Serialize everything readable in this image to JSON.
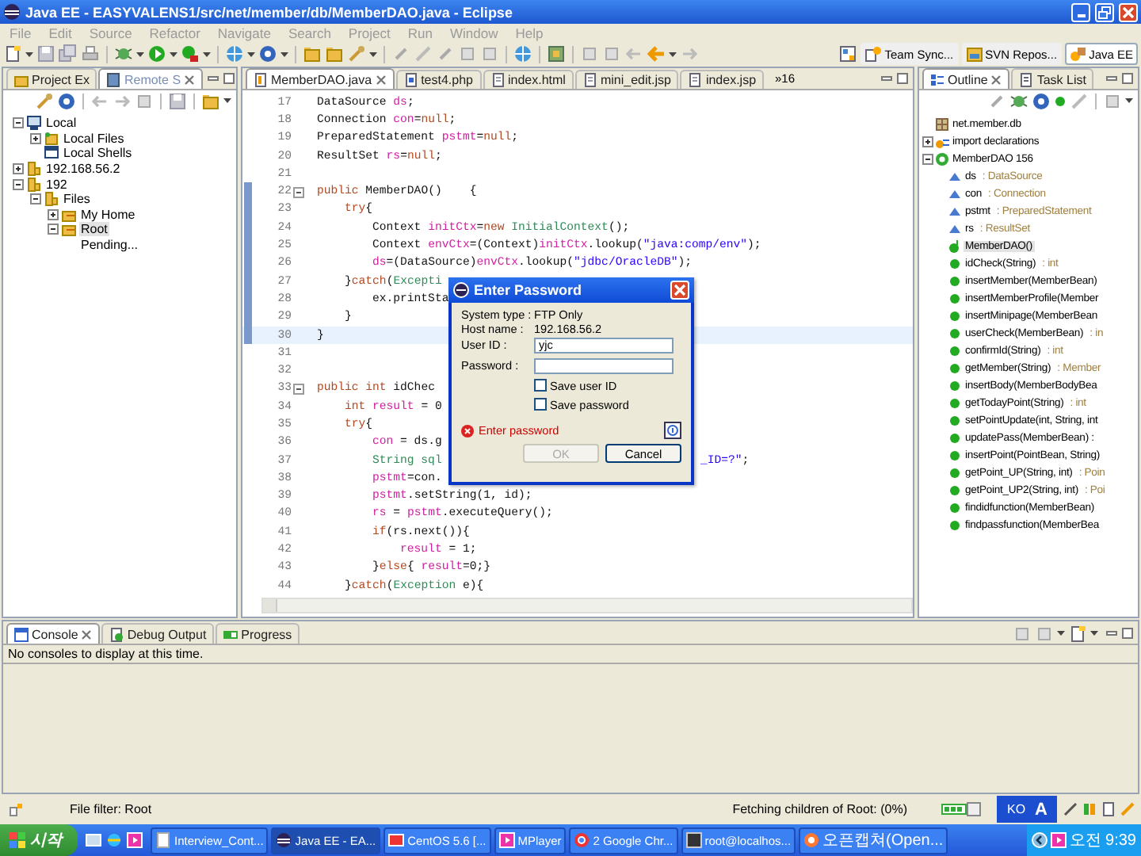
{
  "window": {
    "title": "Java EE - EASYVALENS1/src/net/member/db/MemberDAO.java - Eclipse"
  },
  "menu": [
    {
      "label": "File",
      "disabled": true
    },
    {
      "label": "Edit",
      "disabled": true
    },
    {
      "label": "Source",
      "disabled": true
    },
    {
      "label": "Refactor",
      "disabled": true
    },
    {
      "label": "Navigate",
      "disabled": true
    },
    {
      "label": "Search",
      "disabled": true
    },
    {
      "label": "Project",
      "disabled": true
    },
    {
      "label": "Run",
      "disabled": true
    },
    {
      "label": "Window",
      "disabled": true
    },
    {
      "label": "Help",
      "disabled": true
    }
  ],
  "perspectives": [
    {
      "label": "Team Sync...",
      "kind": "sync",
      "selected": false
    },
    {
      "label": "SVN Repos...",
      "kind": "repo",
      "selected": false
    },
    {
      "label": "Java EE",
      "kind": "javaee",
      "selected": true
    }
  ],
  "left_panel": {
    "tabs": [
      {
        "label": "Project Ex",
        "selected": false
      },
      {
        "label": "Remote S",
        "selected": true
      }
    ],
    "tree": [
      {
        "label": "Local",
        "kind": "system",
        "expanded": true,
        "selected": false,
        "children": [
          {
            "label": "Local Files",
            "kind": "files",
            "expanded": false,
            "selected": false
          },
          {
            "label": "Local Shells",
            "kind": "shells",
            "selected": false
          }
        ]
      },
      {
        "label": "192.168.56.2",
        "kind": "host",
        "expanded": false,
        "selected": false
      },
      {
        "label": "192",
        "kind": "host",
        "expanded": true,
        "selected": false,
        "children": [
          {
            "label": "Files",
            "kind": "host",
            "expanded": true,
            "selected": false,
            "children": [
              {
                "label": "My Home",
                "kind": "folder",
                "expanded": false,
                "selected": false
              },
              {
                "label": "Root",
                "kind": "folder",
                "expanded": true,
                "selected": true,
                "children": [
                  {
                    "label": "Pending...",
                    "selected": false
                  }
                ]
              }
            ]
          }
        ]
      }
    ]
  },
  "editor": {
    "tabs": [
      {
        "label": "MemberDAO.java",
        "kind": "java",
        "selected": true
      },
      {
        "label": "test4.php",
        "kind": "php",
        "selected": false
      },
      {
        "label": "index.html",
        "kind": "file",
        "selected": false
      },
      {
        "label": "mini_edit.jsp",
        "kind": "file",
        "selected": false
      },
      {
        "label": "index.jsp",
        "kind": "file",
        "selected": false
      }
    ],
    "overflow": "»16",
    "lines": [
      {
        "number": "17",
        "current": false,
        "marked": false,
        "fold": false,
        "segments": [
          {
            "text": "DataSource ",
            "kind": "plain"
          },
          {
            "text": "ds",
            "kind": "field"
          },
          {
            "text": ";",
            "kind": "plain"
          }
        ]
      },
      {
        "number": "18",
        "current": false,
        "marked": false,
        "fold": false,
        "segments": [
          {
            "text": "Connection ",
            "kind": "plain"
          },
          {
            "text": "con",
            "kind": "field"
          },
          {
            "text": "=",
            "kind": "plain"
          },
          {
            "text": "null",
            "kind": "keyword"
          },
          {
            "text": ";",
            "kind": "plain"
          }
        ]
      },
      {
        "number": "19",
        "current": false,
        "marked": false,
        "fold": false,
        "segments": [
          {
            "text": "PreparedStatement ",
            "kind": "plain"
          },
          {
            "text": "pstmt",
            "kind": "field"
          },
          {
            "text": "=",
            "kind": "plain"
          },
          {
            "text": "null",
            "kind": "keyword"
          },
          {
            "text": ";",
            "kind": "plain"
          }
        ]
      },
      {
        "number": "20",
        "current": false,
        "marked": false,
        "fold": false,
        "segments": [
          {
            "text": "ResultSet ",
            "kind": "plain"
          },
          {
            "text": "rs",
            "kind": "field"
          },
          {
            "text": "=",
            "kind": "plain"
          },
          {
            "text": "null",
            "kind": "keyword"
          },
          {
            "text": ";",
            "kind": "plain"
          }
        ]
      },
      {
        "number": "21",
        "current": false,
        "marked": false,
        "fold": false
      },
      {
        "number": "22",
        "current": false,
        "marked": true,
        "fold": true,
        "segments": [
          {
            "text": "public",
            "kind": "keyword"
          },
          {
            "text": " MemberDAO()    {",
            "kind": "plain"
          }
        ]
      },
      {
        "number": "23",
        "current": false,
        "marked": true,
        "fold": false,
        "segments": [
          {
            "text": "    try",
            "kind": "keyword"
          },
          {
            "text": "{",
            "kind": "plain"
          }
        ]
      },
      {
        "number": "24",
        "current": false,
        "marked": true,
        "fold": false,
        "segments": [
          {
            "text": "        Context ",
            "kind": "plain"
          },
          {
            "text": "initCtx",
            "kind": "field"
          },
          {
            "text": "=",
            "kind": "plain"
          },
          {
            "text": "new ",
            "kind": "keyword"
          },
          {
            "text": "InitialContext",
            "kind": "type"
          },
          {
            "text": "();",
            "kind": "plain"
          }
        ]
      },
      {
        "number": "25",
        "current": false,
        "marked": true,
        "fold": false,
        "segments": [
          {
            "text": "        Context ",
            "kind": "plain"
          },
          {
            "text": "envCtx",
            "kind": "field"
          },
          {
            "text": "=(Context)",
            "kind": "plain"
          },
          {
            "text": "initCtx",
            "kind": "field"
          },
          {
            "text": ".lookup(",
            "kind": "plain"
          },
          {
            "text": "\"java:comp/env\"",
            "kind": "string"
          },
          {
            "text": ");",
            "kind": "plain"
          }
        ]
      },
      {
        "number": "26",
        "current": false,
        "marked": true,
        "fold": false,
        "segments": [
          {
            "text": "        ds",
            "kind": "field"
          },
          {
            "text": "=(DataSource)",
            "kind": "plain"
          },
          {
            "text": "envCtx",
            "kind": "field"
          },
          {
            "text": ".lookup(",
            "kind": "plain"
          },
          {
            "text": "\"jdbc/OracleDB\"",
            "kind": "string"
          },
          {
            "text": ");",
            "kind": "plain"
          }
        ]
      },
      {
        "number": "27",
        "current": false,
        "marked": true,
        "fold": false,
        "segments": [
          {
            "text": "    }",
            "kind": "plain"
          },
          {
            "text": "catch",
            "kind": "keyword"
          },
          {
            "text": "(",
            "kind": "plain"
          },
          {
            "text": "Excepti",
            "kind": "type"
          }
        ]
      },
      {
        "number": "28",
        "current": false,
        "marked": true,
        "fold": false,
        "segments": [
          {
            "text": "        ex.printSta",
            "kind": "plain"
          }
        ]
      },
      {
        "number": "29",
        "current": false,
        "marked": true,
        "fold": false,
        "segments": [
          {
            "text": "    }",
            "kind": "plain"
          }
        ]
      },
      {
        "number": "30",
        "current": true,
        "marked": true,
        "fold": false,
        "segments": [
          {
            "text": "}",
            "kind": "plain"
          }
        ]
      },
      {
        "number": "31",
        "current": false,
        "marked": false,
        "fold": false
      },
      {
        "number": "32",
        "current": false,
        "marked": false,
        "fold": false
      },
      {
        "number": "33",
        "current": false,
        "marked": false,
        "fold": true,
        "segments": [
          {
            "text": "public int",
            "kind": "keyword"
          },
          {
            "text": " idChec",
            "kind": "plain"
          }
        ]
      },
      {
        "number": "34",
        "current": false,
        "marked": false,
        "fold": false,
        "segments": [
          {
            "text": "    int ",
            "kind": "keyword"
          },
          {
            "text": "result",
            "kind": "field"
          },
          {
            "text": " = 0",
            "kind": "plain"
          }
        ]
      },
      {
        "number": "35",
        "current": false,
        "marked": false,
        "fold": false,
        "segments": [
          {
            "text": "    try",
            "kind": "keyword"
          },
          {
            "text": "{",
            "kind": "plain"
          }
        ]
      },
      {
        "number": "36",
        "current": false,
        "marked": false,
        "fold": false,
        "segments": [
          {
            "text": "        con",
            "kind": "field"
          },
          {
            "text": " = ds.g",
            "kind": "plain"
          }
        ]
      },
      {
        "number": "37",
        "current": false,
        "marked": false,
        "fold": false,
        "segments": [
          {
            "text": "        String sql",
            "kind": "type"
          }
        ],
        "tail": [
          {
            "text": "_ID=?\"",
            "kind": "string"
          },
          {
            "text": ";",
            "kind": "plain"
          }
        ]
      },
      {
        "number": "38",
        "current": false,
        "marked": false,
        "fold": false,
        "segments": [
          {
            "text": "        pstmt",
            "kind": "field"
          },
          {
            "text": "=con.",
            "kind": "plain"
          }
        ]
      },
      {
        "number": "39",
        "current": false,
        "marked": false,
        "fold": false,
        "segments": [
          {
            "text": "        pstmt",
            "kind": "field"
          },
          {
            "text": ".setString(1, id);",
            "kind": "plain"
          }
        ]
      },
      {
        "number": "40",
        "current": false,
        "marked": false,
        "fold": false,
        "segments": [
          {
            "text": "        rs",
            "kind": "field"
          },
          {
            "text": " = ",
            "kind": "plain"
          },
          {
            "text": "pstmt",
            "kind": "field"
          },
          {
            "text": ".executeQuery();",
            "kind": "plain"
          }
        ]
      },
      {
        "number": "41",
        "current": false,
        "marked": false,
        "fold": false,
        "segments": [
          {
            "text": "        if",
            "kind": "keyword"
          },
          {
            "text": "(rs.next()){",
            "kind": "plain"
          }
        ]
      },
      {
        "number": "42",
        "current": false,
        "marked": false,
        "fold": false,
        "segments": [
          {
            "text": "            result",
            "kind": "field"
          },
          {
            "text": " = 1;",
            "kind": "plain"
          }
        ]
      },
      {
        "number": "43",
        "current": false,
        "marked": false,
        "fold": false,
        "segments": [
          {
            "text": "        }",
            "kind": "plain"
          },
          {
            "text": "else",
            "kind": "keyword"
          },
          {
            "text": "{ ",
            "kind": "plain"
          },
          {
            "text": "result",
            "kind": "field"
          },
          {
            "text": "=0;}",
            "kind": "plain"
          }
        ]
      },
      {
        "number": "44",
        "current": false,
        "marked": false,
        "fold": false,
        "segments": [
          {
            "text": "    }",
            "kind": "plain"
          },
          {
            "text": "catch",
            "kind": "keyword"
          },
          {
            "text": "(",
            "kind": "plain"
          },
          {
            "text": "Exception",
            "kind": "type"
          },
          {
            "text": " e){",
            "kind": "plain"
          }
        ]
      }
    ]
  },
  "outline": {
    "tabs": [
      {
        "label": "Outline",
        "selected": true
      },
      {
        "label": "Task List",
        "selected": false
      }
    ],
    "items": [
      {
        "name": "net.member.db",
        "kind": "package",
        "selected": false
      },
      {
        "name": "import declarations",
        "kind": "imports",
        "expanded": false,
        "selected": false
      },
      {
        "name": "MemberDAO 156",
        "kind": "class",
        "expanded": true,
        "selected": false,
        "children": [
          {
            "name": "ds",
            "type": ": DataSource",
            "kind": "field",
            "selected": false
          },
          {
            "name": "con",
            "type": ": Connection",
            "kind": "field",
            "selected": false
          },
          {
            "name": "pstmt",
            "type": ": PreparedStatement",
            "kind": "field",
            "selected": false
          },
          {
            "name": "rs",
            "type": ": ResultSet",
            "kind": "field",
            "selected": false
          },
          {
            "name": "MemberDAO()",
            "kind": "constructor",
            "selected": true
          },
          {
            "name": "idCheck(String)",
            "type": ": int",
            "kind": "method",
            "selected": false
          },
          {
            "name": "insertMember(MemberBean)",
            "kind": "method",
            "selected": false
          },
          {
            "name": "insertMemberProfile(Member",
            "kind": "method",
            "selected": false
          },
          {
            "name": "insertMinipage(MemberBean",
            "kind": "method",
            "selected": false
          },
          {
            "name": "userCheck(MemberBean)",
            "type": ": in",
            "kind": "method",
            "selected": false
          },
          {
            "name": "confirmId(String)",
            "type": ": int",
            "kind": "method",
            "selected": false
          },
          {
            "name": "getMember(String)",
            "type": ": Member",
            "kind": "method",
            "selected": false
          },
          {
            "name": "insertBody(MemberBodyBea",
            "kind": "method",
            "selected": false
          },
          {
            "name": "getTodayPoint(String)",
            "type": ": int",
            "kind": "method",
            "selected": false
          },
          {
            "name": "setPointUpdate(int, String, int",
            "kind": "method",
            "selected": false
          },
          {
            "name": "updatePass(MemberBean) :",
            "kind": "method",
            "selected": false
          },
          {
            "name": "insertPoint(PointBean, String)",
            "kind": "method",
            "selected": false
          },
          {
            "name": "getPoint_UP(String, int)",
            "type": ": Poin",
            "kind": "method",
            "selected": false
          },
          {
            "name": "getPoint_UP2(String, int)",
            "type": ": Poi",
            "kind": "method",
            "selected": false
          },
          {
            "name": "findidfunction(MemberBean)",
            "kind": "method",
            "selected": false
          },
          {
            "name": "findpassfunction(MemberBea",
            "kind": "method",
            "selected": false
          }
        ]
      }
    ]
  },
  "console": {
    "tabs": [
      {
        "label": "Console",
        "selected": true
      },
      {
        "label": "Debug Output",
        "selected": false
      },
      {
        "label": "Progress",
        "selected": false
      }
    ],
    "message": "No consoles to display at this time."
  },
  "status_bar": {
    "filter": "File filter: Root",
    "progress": "Fetching children of Root: (0%)",
    "language": "KO",
    "ime": "A"
  },
  "dialog": {
    "title": "Enter Password",
    "info": [
      {
        "label": "System type :",
        "value": "FTP Only"
      },
      {
        "label": "Host name :",
        "value": "192.168.56.2"
      }
    ],
    "fields": [
      {
        "label": "User ID :",
        "value": "yjc"
      },
      {
        "label": "Password :"
      }
    ],
    "checkboxes": [
      {
        "label": "Save user ID",
        "checked": false
      },
      {
        "label": "Save password",
        "checked": false
      }
    ],
    "error": "Enter password",
    "buttons": [
      {
        "label": "OK",
        "disabled": true
      },
      {
        "label": "Cancel",
        "disabled": false
      }
    ]
  },
  "taskbar": {
    "start": "시작",
    "tasks": [
      {
        "label": "Interview_Cont...",
        "kind": "doc",
        "selected": false
      },
      {
        "label": "Java EE - EA...",
        "kind": "eclipse",
        "selected": true
      },
      {
        "label": "CentOS 5.6 [...",
        "kind": "vm",
        "selected": false
      },
      {
        "label": "MPlayer",
        "kind": "player",
        "selected": false
      },
      {
        "label": "2 Google Chr...",
        "kind": "browser",
        "selected": false
      },
      {
        "label": "root@localhos...",
        "kind": "terminal",
        "selected": false
      },
      {
        "label": "오픈캡쳐(Open...",
        "kind": "capture",
        "selected": false
      }
    ],
    "clock": "오전 9:39"
  }
}
